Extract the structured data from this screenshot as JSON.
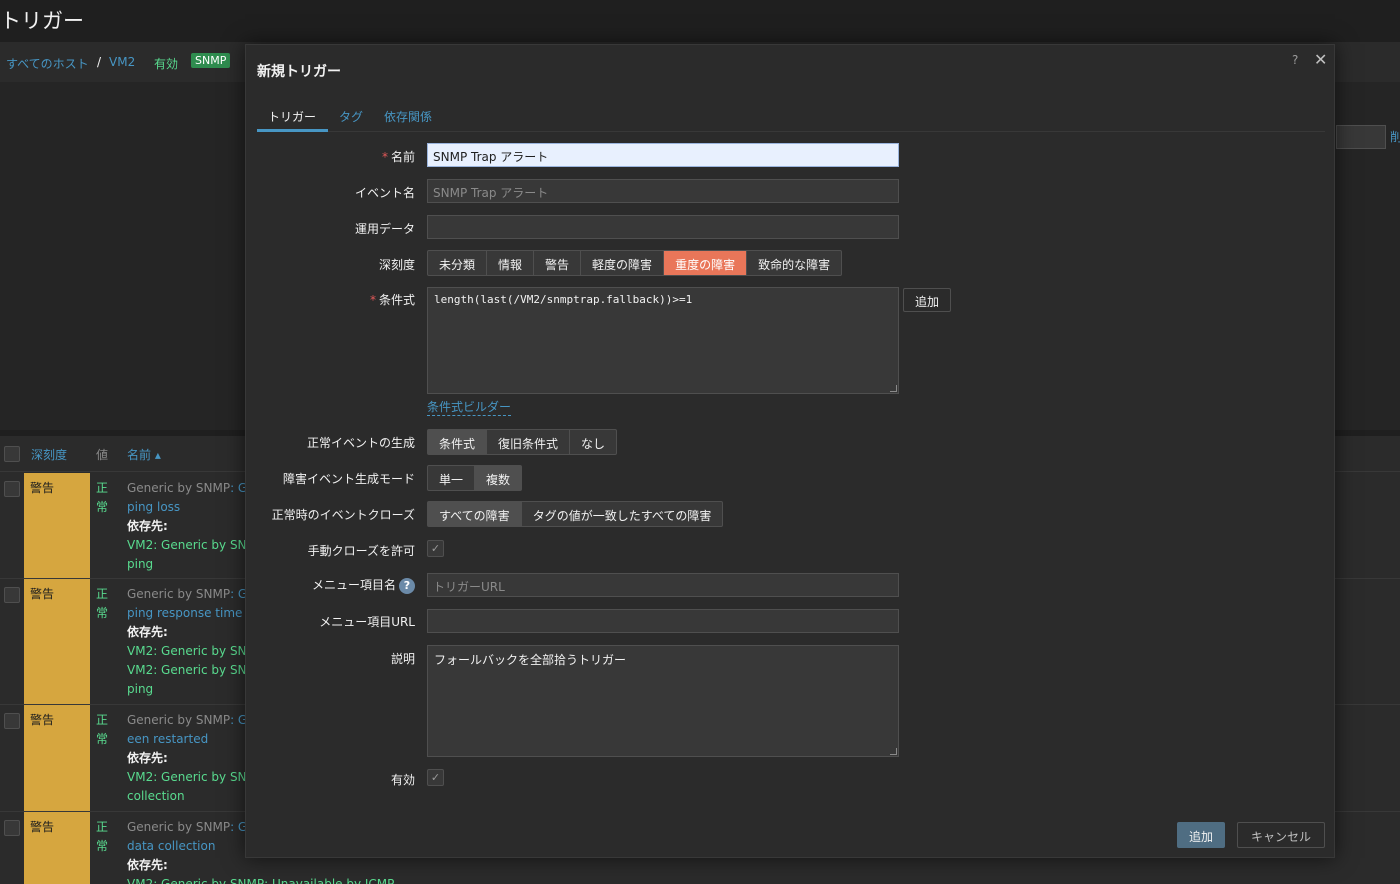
{
  "background": {
    "page_title": "トリガー",
    "breadcrumb": {
      "all_hosts": "すべてのホスト",
      "separator": "/",
      "host": "VM2",
      "status": "有効",
      "badge": "SNMP"
    },
    "filter_link": "削",
    "list": {
      "headers": {
        "severity": "深刻度",
        "value": "値",
        "name": "名前 ▴"
      },
      "rows": [
        {
          "severity": "警告",
          "status": "正常",
          "template": "Generic by SNMP",
          "template_suffix": ": G",
          "trigger": "ping loss",
          "depends_label": "依存先:",
          "deps": [
            "VM2: Generic by SNM",
            "ping"
          ]
        },
        {
          "severity": "警告",
          "status": "正常",
          "template": "Generic by SNMP",
          "template_suffix": ": G",
          "trigger": "ping response time",
          "depends_label": "依存先:",
          "deps": [
            "VM2: Generic by SNM",
            "VM2: Generic by SNM",
            "ping"
          ]
        },
        {
          "severity": "警告",
          "status": "正常",
          "template": "Generic by SNMP",
          "template_suffix": ": G",
          "trigger": "een restarted",
          "depends_label": "依存先:",
          "deps": [
            "VM2: Generic by SNM",
            "collection"
          ]
        },
        {
          "severity": "警告",
          "status": "正常",
          "template": "Generic by SNMP",
          "template_suffix": ": G",
          "trigger": "data collection",
          "depends_label": "依存先:",
          "deps": [
            "VM2: Generic by SNMP: Unavailable by ICMP"
          ]
        }
      ]
    }
  },
  "modal": {
    "title": "新規トリガー",
    "help": "?",
    "close": "✕",
    "tabs": [
      "トリガー",
      "タグ",
      "依存関係"
    ],
    "fields": {
      "name_label": "名前",
      "name_value": "SNMP Trap アラート",
      "event_name_label": "イベント名",
      "event_name_placeholder": "SNMP Trap アラート",
      "opdata_label": "運用データ",
      "opdata_value": "",
      "severity_label": "深刻度",
      "severity_options": [
        "未分類",
        "情報",
        "警告",
        "軽度の障害",
        "重度の障害",
        "致命的な障害"
      ],
      "severity_selected": "重度の障害",
      "expression_label": "条件式",
      "expression_value": "length(last(/VM2/snmptrap.fallback))>=1",
      "expression_add": "追加",
      "expression_builder": "条件式ビルダー",
      "ok_event_label": "正常イベントの生成",
      "ok_event_options": [
        "条件式",
        "復旧条件式",
        "なし"
      ],
      "ok_event_selected": "条件式",
      "problem_mode_label": "障害イベント生成モード",
      "problem_mode_options": [
        "単一",
        "複数"
      ],
      "problem_mode_selected": "複数",
      "ok_close_label": "正常時のイベントクローズ",
      "ok_close_options": [
        "すべての障害",
        "タグの値が一致したすべての障害"
      ],
      "ok_close_selected": "すべての障害",
      "manual_close_label": "手動クローズを許可",
      "manual_close_checked": true,
      "menu_name_label": "メニュー項目名",
      "menu_name_help": "?",
      "menu_name_placeholder": "トリガーURL",
      "menu_url_label": "メニュー項目URL",
      "menu_url_value": "",
      "description_label": "説明",
      "description_value": "フォールバックを全部拾うトリガー",
      "enabled_label": "有効",
      "enabled_checked": true
    },
    "buttons": {
      "add": "追加",
      "cancel": "キャンセル"
    }
  },
  "colors": {
    "accent": "#4796c4",
    "severity_high": "#e97659",
    "severity_warning": "#d6a63f",
    "ok_green": "#59db8f"
  },
  "icons": {
    "check": "✓",
    "close": "close-icon",
    "help": "help-icon",
    "sort": "sort-asc-icon"
  }
}
